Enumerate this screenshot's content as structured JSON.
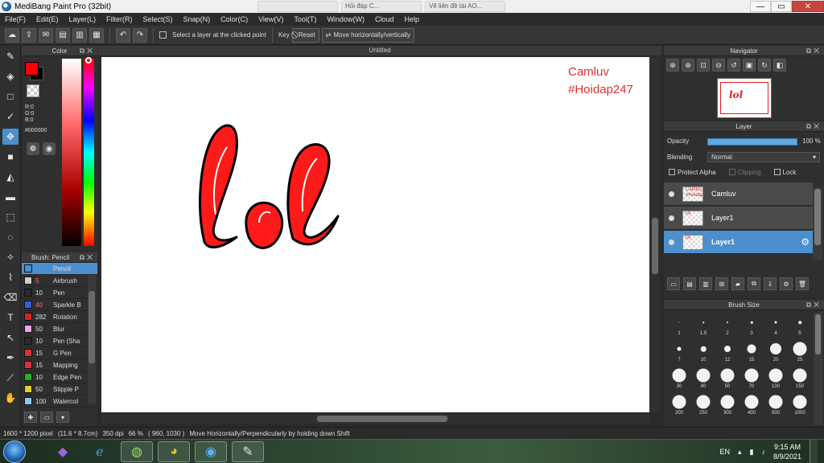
{
  "window": {
    "title": "MediBang Paint Pro (32bit)",
    "bg_tabs": [
      "",
      "Hỏi đáp C...",
      "Vẽ liên đề tài AO..."
    ],
    "minimize": "—",
    "restore": "▭",
    "close": "✕"
  },
  "menu": [
    "File(F)",
    "Edit(E)",
    "Layer(L)",
    "Filter(R)",
    "Select(S)",
    "Snap(N)",
    "Color(C)",
    "View(V)",
    "Tool(T)",
    "Window(W)",
    "Cloud",
    "Help"
  ],
  "toolbar": {
    "select_layer_label": "Select a layer at the clicked point",
    "key_label": "Key",
    "reset_label": "Reset",
    "move_label": "Move horizontally/vertically"
  },
  "color_panel": {
    "title": "Color",
    "foreground": "#ff0000",
    "background": "#000000",
    "r": "R:0",
    "g": "G:0",
    "b": "B:0",
    "hex": "#000000"
  },
  "brush_panel": {
    "title": "Brush: Pencil",
    "items": [
      {
        "size": "",
        "name": "Pencil",
        "color": "#4c8fcf"
      },
      {
        "size": "5",
        "name": "Airbrush",
        "color": "#cfcfcf"
      },
      {
        "size": "10",
        "name": "Pen",
        "color": "#2a2a2a"
      },
      {
        "size": "40",
        "name": "Sparkle B",
        "color": "#3a5be0"
      },
      {
        "size": "282",
        "name": "Rotation",
        "color": "#e02020"
      },
      {
        "size": "50",
        "name": "Blur",
        "color": "#f2a0f0"
      },
      {
        "size": "10",
        "name": "Pen (Sha",
        "color": "#2a2a2a"
      },
      {
        "size": "15",
        "name": "G Pen",
        "color": "#e03030"
      },
      {
        "size": "15",
        "name": "Mapping",
        "color": "#e03030"
      },
      {
        "size": "10",
        "name": "Edge Pen",
        "color": "#20b020"
      },
      {
        "size": "50",
        "name": "Stipple P",
        "color": "#e0d020"
      },
      {
        "size": "100",
        "name": "Watercol",
        "color": "#7fd0f0"
      }
    ]
  },
  "document": {
    "tab": "Untitled",
    "signature_line1": "Camluv",
    "signature_line2": "#Hoidap247",
    "artwork_color": "#ff0000"
  },
  "navigator": {
    "title": "Navigator",
    "thumb_text": "lol"
  },
  "layer_panel": {
    "title": "Layer",
    "opacity_label": "Opacity",
    "opacity_value": "100 %",
    "opacity_fraction": 1.0,
    "blending_label": "Blending",
    "blending_value": "Normal",
    "protect_alpha": "Protect Alpha",
    "clipping": "Clipping",
    "lock": "Lock",
    "layers": [
      {
        "name": "Camluv",
        "thumb": "Camluv #Hoidap247",
        "selected": false
      },
      {
        "name": "Layer1",
        "thumb": "lol",
        "selected": false
      },
      {
        "name": "Layer1",
        "thumb": "lol",
        "selected": true
      }
    ]
  },
  "brush_size_panel": {
    "title": "Brush Size",
    "sizes": [
      "1",
      "1.5",
      "2",
      "3",
      "4",
      "5",
      "7",
      "10",
      "12",
      "15",
      "20",
      "25",
      "30",
      "40",
      "50",
      "70",
      "100",
      "150",
      "200",
      "250",
      "300",
      "400",
      "500",
      "1000"
    ]
  },
  "status": {
    "dimensions": "1600 * 1200 pixel",
    "physical": "(11.6 * 8.7cm)",
    "dpi": "350 dpi",
    "zoom": "66 %",
    "coords": "( 960, 1030 )",
    "message": "Move Horizontally/Perpendicularly by holding down Shift"
  },
  "taskbar": {
    "lang": "EN",
    "time": "9:15 AM",
    "date": "8/9/2021"
  }
}
